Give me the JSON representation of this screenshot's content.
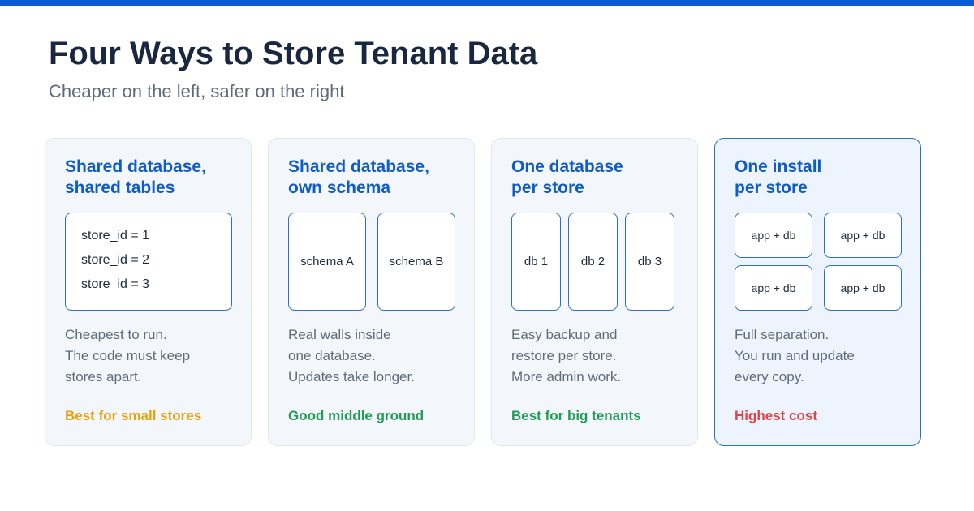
{
  "header": {
    "title": "Four Ways to Store Tenant Data",
    "subtitle": "Cheaper on the left, safer on the right",
    "accent_color": "#0b5ad6"
  },
  "cards": [
    {
      "title_lines": [
        "Shared database,",
        "shared tables"
      ],
      "rows": [
        "store_id = 1",
        "store_id = 2",
        "store_id = 3"
      ],
      "desc_lines": [
        "Cheapest to run.",
        "The code must keep",
        "stores apart."
      ],
      "verdict": "Best for small stores",
      "verdict_color": "#e8a20c"
    },
    {
      "title_lines": [
        "Shared database,",
        "own schema"
      ],
      "boxes": [
        "schema A",
        "schema B"
      ],
      "desc_lines": [
        "Real walls inside",
        "one database.",
        "Updates take longer."
      ],
      "verdict": "Good middle ground",
      "verdict_color": "#1f9d55"
    },
    {
      "title_lines": [
        "One database",
        "per store"
      ],
      "boxes": [
        "db 1",
        "db 2",
        "db 3"
      ],
      "desc_lines": [
        "Easy backup and",
        "restore per store.",
        "More admin work."
      ],
      "verdict": "Best for big tenants",
      "verdict_color": "#1f9d55"
    },
    {
      "title_lines": [
        "One install",
        "per store"
      ],
      "boxes": [
        "app + db",
        "app + db",
        "app + db",
        "app + db"
      ],
      "desc_lines": [
        "Full separation.",
        "You run and update",
        "every copy."
      ],
      "verdict": "Highest cost",
      "verdict_color": "#e0434b"
    }
  ]
}
